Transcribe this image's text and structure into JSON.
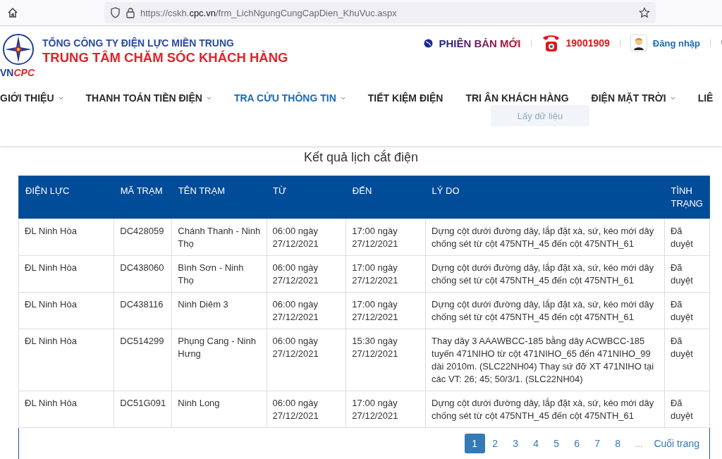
{
  "browser": {
    "url_prefix": "https://cskh.",
    "url_domain": "cpc.vn",
    "url_path": "/frm_LichNgungCungCapDien_KhuVuc.aspx"
  },
  "header": {
    "company": "TỔNG CÔNG TY ĐIỆN LỰC MIỀN TRUNG",
    "center": "TRUNG TÂM CHĂM SÓC KHÁCH HÀNG",
    "brand_prefix": "VN",
    "brand_suffix": "CPC",
    "new_version": "PHIÊN BẢN MỚI",
    "hotline": "19001909",
    "login": "Đăng nhập"
  },
  "nav": [
    {
      "label": "GIỚI THIỆU",
      "has_menu": true,
      "selected": false
    },
    {
      "label": "THANH TOÁN TIỀN ĐIỆN",
      "has_menu": true,
      "selected": false
    },
    {
      "label": "TRA CỨU THÔNG TIN",
      "has_menu": true,
      "selected": true
    },
    {
      "label": "TIẾT KIỆM ĐIỆN",
      "has_menu": false,
      "selected": false
    },
    {
      "label": "TRI ÂN KHÁCH HÀNG",
      "has_menu": false,
      "selected": false
    },
    {
      "label": "ĐIỆN MẶT TRỜI",
      "has_menu": true,
      "selected": false
    },
    {
      "label": "LIÊ",
      "has_menu": false,
      "selected": false
    }
  ],
  "form": {
    "submit": "Lấy dữ liệu"
  },
  "results": {
    "title": "Kết quả lịch cắt điện",
    "columns": [
      "ĐIỆN LỰC",
      "MÃ TRẠM",
      "TÊN TRẠM",
      "TỪ",
      "ĐẾN",
      "LÝ DO",
      "TÌNH TRẠNG"
    ],
    "rows": [
      [
        "ĐL Ninh Hòa",
        "DC428059",
        "Chánh Thanh - Ninh Thọ",
        "06:00 ngày 27/12/2021",
        "17:00 ngày 27/12/2021",
        "Dựng cột dưới đường dây, lắp đặt xà, sứ, kéo mới dây chống sét từ cột 475NTH_45 đến cột 475NTH_61",
        "Đã duyệt"
      ],
      [
        "ĐL Ninh Hòa",
        "DC438060",
        "Bình Sơn - Ninh Thọ",
        "06:00 ngày 27/12/2021",
        "17:00 ngày 27/12/2021",
        "Dựng cột dưới đường dây, lắp đặt xà, sứ, kéo mới dây chống sét từ cột 475NTH_45 đến cột 475NTH_61",
        "Đã duyệt"
      ],
      [
        "ĐL Ninh Hòa",
        "DC438116",
        "Ninh Diêm 3",
        "06:00 ngày 27/12/2021",
        "17:00 ngày 27/12/2021",
        "Dựng cột dưới đường dây, lắp đặt xà, sứ, kéo mới dây chống sét từ cột 475NTH_45 đến cột 475NTH_61",
        "Đã duyệt"
      ],
      [
        "ĐL Ninh Hòa",
        "DC514299",
        "Phụng Cang - Ninh Hưng",
        "06:00 ngày 27/12/2021",
        "15:30 ngày 27/12/2021",
        "Thay dây 3 AAAWBCC-185 bằng dây ACWBCC-185 tuyến 471NIHO từ cột 471NIHO_65 đến 471NIHO_99 dài 2010m. (SLC22NH04) Thay sứ đỡ XT 471NIHO tại các VT: 26; 45; 50/3/1. (SLC22NH04)",
        "Đã duyệt"
      ],
      [
        "ĐL Ninh Hòa",
        "DC51G091",
        "Ninh Long",
        "06:00 ngày 27/12/2021",
        "17:00 ngày 27/12/2021",
        "Dựng cột dưới đường dây, lắp đặt xà, sứ, kéo mới dây chống sét từ cột 475NTH_45 đến cột 475NTH_61",
        "Đã duyệt"
      ]
    ],
    "pages": [
      {
        "label": "1",
        "selected": true
      },
      {
        "label": "2",
        "selected": false
      },
      {
        "label": "3",
        "selected": false
      },
      {
        "label": "4",
        "selected": false
      },
      {
        "label": "5",
        "selected": false
      },
      {
        "label": "6",
        "selected": false
      },
      {
        "label": "7",
        "selected": false
      },
      {
        "label": "8",
        "selected": false
      }
    ],
    "ellipsis": "...",
    "last": "Cuối trang"
  }
}
